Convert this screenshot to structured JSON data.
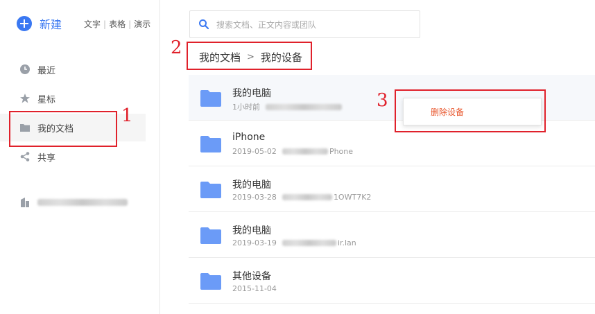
{
  "sidebar": {
    "new_label": "新建",
    "quick_links": [
      "文字",
      "表格",
      "演示"
    ],
    "items": [
      {
        "label": "最近",
        "icon": "clock-icon"
      },
      {
        "label": "星标",
        "icon": "star-icon"
      },
      {
        "label": "我的文档",
        "icon": "folder-icon"
      },
      {
        "label": "共享",
        "icon": "share-icon"
      }
    ],
    "team_icon": "building-icon"
  },
  "search": {
    "placeholder": "搜索文档、正文内容或团队"
  },
  "breadcrumb": [
    "我的文档",
    "我的设备"
  ],
  "breadcrumb_separator": ">",
  "files": [
    {
      "name": "我的电脑",
      "date": "1小时前",
      "device_suffix": "",
      "icon": "folder-icon"
    },
    {
      "name": "iPhone",
      "date": "2019-05-02",
      "device_suffix": "Phone",
      "icon": "folder-icon"
    },
    {
      "name": "我的电脑",
      "date": "2019-03-28",
      "device_suffix": "1OWT7K2",
      "icon": "folder-icon"
    },
    {
      "name": "我的电脑",
      "date": "2019-03-19",
      "device_suffix": "ir.lan",
      "icon": "folder-icon"
    },
    {
      "name": "其他设备",
      "date": "2015-11-04",
      "device_suffix": "",
      "icon": "folder-icon"
    }
  ],
  "context_menu": {
    "delete_label": "删除设备"
  },
  "annotations": [
    "1",
    "2",
    "3"
  ],
  "colors": {
    "accent": "#3a78f2",
    "folder": "#6b9bf7",
    "annotation": "#e0212b",
    "danger": "#e8552b"
  }
}
